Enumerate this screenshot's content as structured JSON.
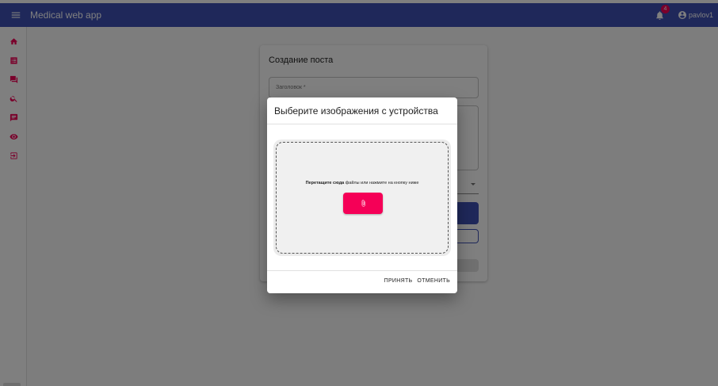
{
  "appbar": {
    "title": "Medical web app",
    "notifications_count": "4",
    "username": "pavlov1"
  },
  "sidebar": {
    "items": [
      {
        "icon": "home-icon"
      },
      {
        "icon": "list-icon"
      },
      {
        "icon": "forum-icon"
      },
      {
        "icon": "search-icon"
      },
      {
        "icon": "chat-icon"
      },
      {
        "icon": "eye-icon"
      },
      {
        "icon": "logout-icon"
      }
    ]
  },
  "post_form": {
    "title": "Создание поста",
    "title_placeholder": "Заголовок *"
  },
  "dialog": {
    "title": "Выберите изображения с устройства",
    "dropzone_bold": "Перетащите сюда",
    "dropzone_rest": " файлы или нажмите на кнопку ниже",
    "accept_label": "ПРИНЯТЬ",
    "cancel_label": "ОТМЕНИТЬ"
  },
  "colors": {
    "primary": "#3f51b5",
    "secondary": "#f50057"
  }
}
